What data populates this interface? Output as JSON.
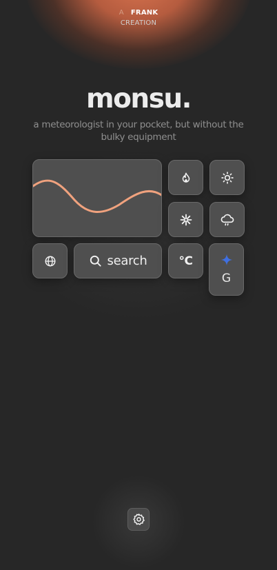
{
  "credit": {
    "line1_prefix": "A",
    "line1_name": "FRANK",
    "line2": "CREATION"
  },
  "app": {
    "title": "monsu.",
    "tagline": "a meteorologist in your pocket, but without the bulky equipment"
  },
  "controls": {
    "search_label": "search",
    "unit_label": "°C",
    "gem_letter": "G"
  },
  "icons": {
    "graph": "temperature-wave-graph",
    "fire": "flame-icon",
    "sun": "sun-icon",
    "snow": "snowflake-icon",
    "rain": "cloud-rain-icon",
    "globe": "globe-icon",
    "search": "search-icon",
    "gem": "sparkle-icon",
    "settings": "gear-icon"
  },
  "colors": {
    "background": "#272727",
    "accent_glow": "#d8734f",
    "wave": "#f0a27e",
    "tile": "#4f4f4f",
    "sparkle": "#3f6fe0"
  }
}
